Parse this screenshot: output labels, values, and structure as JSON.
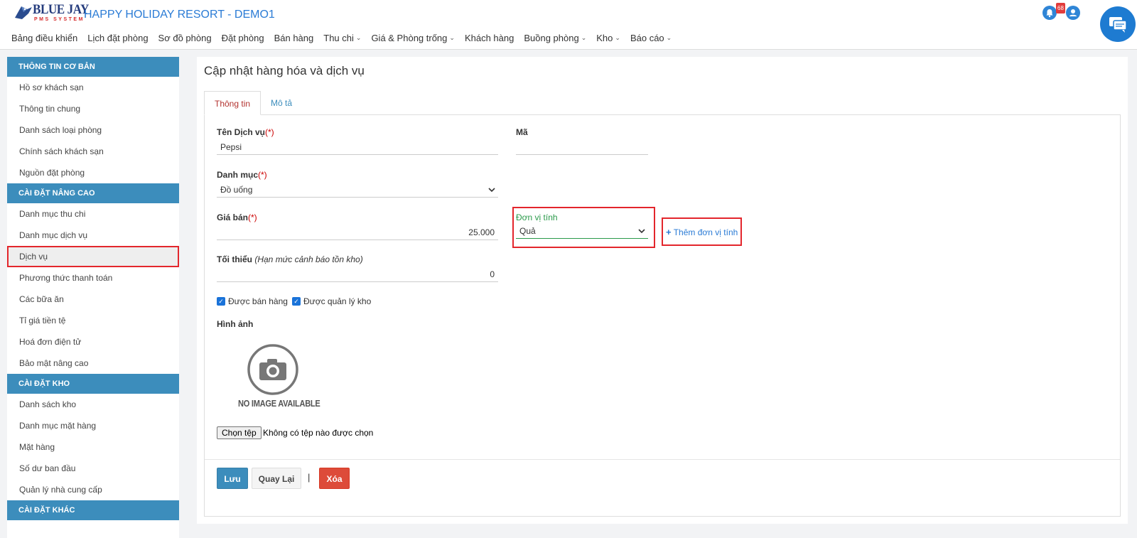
{
  "header": {
    "logo_text": "BLUE JAY",
    "logo_sub": "PMS SYSTEM",
    "app_title": "HAPPY HOLIDAY RESORT - DEMO1",
    "notification_count": "68",
    "nav": [
      {
        "label": "Bảng điều khiển",
        "dropdown": false
      },
      {
        "label": "Lịch đặt phòng",
        "dropdown": false
      },
      {
        "label": "Sơ đồ phòng",
        "dropdown": false
      },
      {
        "label": "Đặt phòng",
        "dropdown": false
      },
      {
        "label": "Bán hàng",
        "dropdown": false
      },
      {
        "label": "Thu chi",
        "dropdown": true
      },
      {
        "label": "Giá & Phòng trống",
        "dropdown": true
      },
      {
        "label": "Khách hàng",
        "dropdown": false
      },
      {
        "label": "Buồng phòng",
        "dropdown": true
      },
      {
        "label": "Kho",
        "dropdown": true
      },
      {
        "label": "Báo cáo",
        "dropdown": true
      }
    ]
  },
  "sidebar": {
    "sections": [
      {
        "title": "THÔNG TIN CƠ BẢN",
        "items": [
          "Hồ sơ khách sạn",
          "Thông tin chung",
          "Danh sách loại phòng",
          "Chính sách khách sạn",
          "Nguồn đặt phòng"
        ]
      },
      {
        "title": "CÀI ĐẶT NÂNG CAO",
        "items": [
          "Danh mục thu chi",
          "Danh mục dịch vụ",
          "Dịch vụ",
          "Phương thức thanh toán",
          "Các bữa ăn",
          "Tỉ giá tiền tệ",
          "Hoá đơn điện tử",
          "Bảo mật nâng cao"
        ]
      },
      {
        "title": "CÀI ĐẶT KHO",
        "items": [
          "Danh sách kho",
          "Danh mục mặt hàng",
          "Mặt hàng",
          "Số dư ban đầu",
          "Quản lý nhà cung cấp"
        ]
      },
      {
        "title": "CÀI ĐẶT KHÁC",
        "items": []
      }
    ],
    "active_item": "Dịch vụ"
  },
  "main": {
    "page_title": "Cập nhật hàng hóa và dịch vụ",
    "tabs": [
      "Thông tin",
      "Mô tả"
    ],
    "form": {
      "service_name_label": "Tên Dịch vụ",
      "service_name_value": "Pepsi",
      "code_label": "Mã",
      "code_value": "",
      "category_label": "Danh mục",
      "category_value": "Đồ uống",
      "price_label": "Giá bán",
      "price_value": "25.000",
      "unit_label": "Đơn vị tính",
      "unit_value": "Quả",
      "add_unit_label": "Thêm đơn vị tính",
      "min_label": "Tối thiểu",
      "min_hint": "(Hạn mức cảnh báo tồn kho)",
      "min_value": "0",
      "required_mark": "(*)",
      "can_sell_label": "Được bán hàng",
      "stock_managed_label": "Được quản lý kho",
      "image_label": "Hình ảnh",
      "no_image_text": "NO IMAGE AVAILABLE",
      "file_button": "Chọn tệp",
      "file_status": "Không có tệp nào được chọn"
    },
    "buttons": {
      "save": "Lưu",
      "back": "Quay Lại",
      "separator": "|",
      "delete": "Xóa"
    }
  },
  "colors": {
    "brand_blue": "#3c8dbc",
    "highlight_red": "#e3262c",
    "delete_red": "#dd4b39",
    "focus_green": "#2a9a4a"
  }
}
